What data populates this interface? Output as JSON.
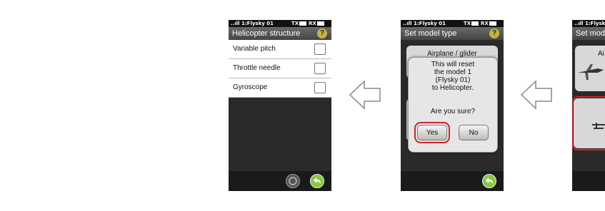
{
  "screen1": {
    "status": {
      "signal": "..ıll",
      "model": "1:Flysky 01",
      "tx": "TX",
      "rx": "RX"
    },
    "title": "Helicopter structure",
    "help": "?",
    "rows": [
      {
        "label": "Variable pitch"
      },
      {
        "label": "Throttle needle"
      },
      {
        "label": "Gyroscope"
      }
    ]
  },
  "screen2": {
    "status": {
      "signal": "..ıll",
      "model": "1:Flysky 01",
      "tx": "TX",
      "rx": "RX"
    },
    "title": "Set model type",
    "help": "?",
    "card_label": "Airplane / glider",
    "dialog": {
      "message": "This will reset\nthe model 1\n(Flysky 01)\nto Helicopter.",
      "question": "Are you sure?",
      "yes": "Yes",
      "no": "No"
    }
  },
  "screen3": {
    "status": {
      "signal": "..ıll",
      "model": "1:Flysky"
    },
    "title": "Set mod",
    "card_label": "Ai"
  },
  "colors": {
    "accent_green": "#8cc63f",
    "highlight_red": "#d4202a",
    "help_yellow": "#c9b23a"
  }
}
